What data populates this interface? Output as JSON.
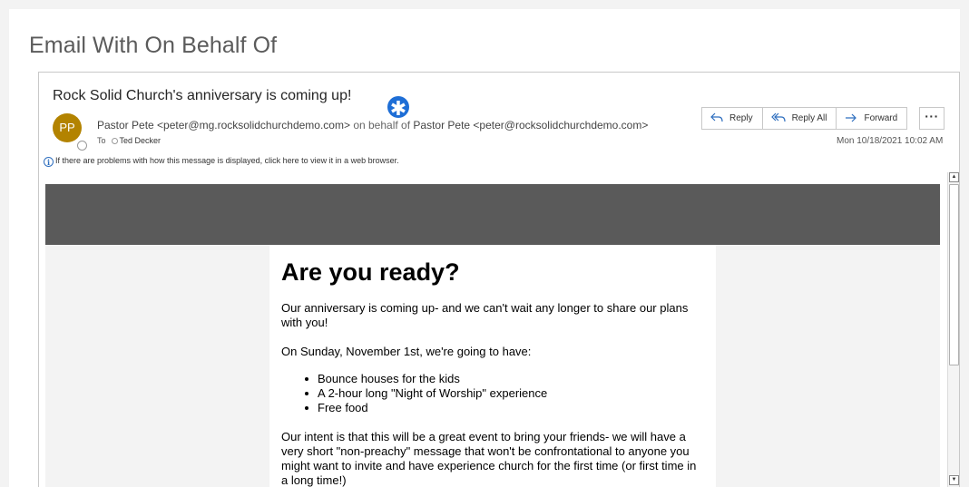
{
  "page": {
    "title": "Email With On Behalf Of"
  },
  "email": {
    "subject": "Rock Solid Church's anniversary is coming up!",
    "marker_symbol": "✱",
    "avatar_initials": "PP",
    "avatar_color": "#b38300",
    "sender": "Pastor Pete <peter@mg.rocksolidchurchdemo.com>",
    "behalf_text": "on behalf of",
    "behalf_sender": "Pastor Pete <peter@rocksolidchurchdemo.com>",
    "to_label": "To",
    "recipient": "Ted Decker",
    "info_text": "If there are problems with how this message is displayed, click here to view it in a web browser.",
    "timestamp": "Mon 10/18/2021 10:02 AM"
  },
  "actions": {
    "reply_label": "Reply",
    "reply_icon": "reply-arrow",
    "reply_all_label": "Reply All",
    "reply_all_icon": "reply-all-arrow",
    "forward_label": "Forward",
    "forward_icon": "forward-arrow",
    "more_label": "···"
  },
  "message": {
    "header_band_color": "#5a5a5a",
    "heading": "Are you ready?",
    "paragraph_1": "Our anniversary is coming up- and we can't wait any longer to share our plans with you!",
    "paragraph_2": "On Sunday, November 1st, we're going to have:",
    "list_items": [
      "Bounce houses for the kids",
      "A 2-hour long \"Night of Worship\" experience",
      "Free food"
    ],
    "paragraph_3": "Our intent is that this will be a great event to bring your friends- we will have a very short \"non-preachy\" message that won't be confrontational to anyone you might want to invite and have experience church for the first time (or first time in a long time!)"
  },
  "colors": {
    "accent": "#1e6ed6",
    "link_icon": "#2f6fbf"
  }
}
